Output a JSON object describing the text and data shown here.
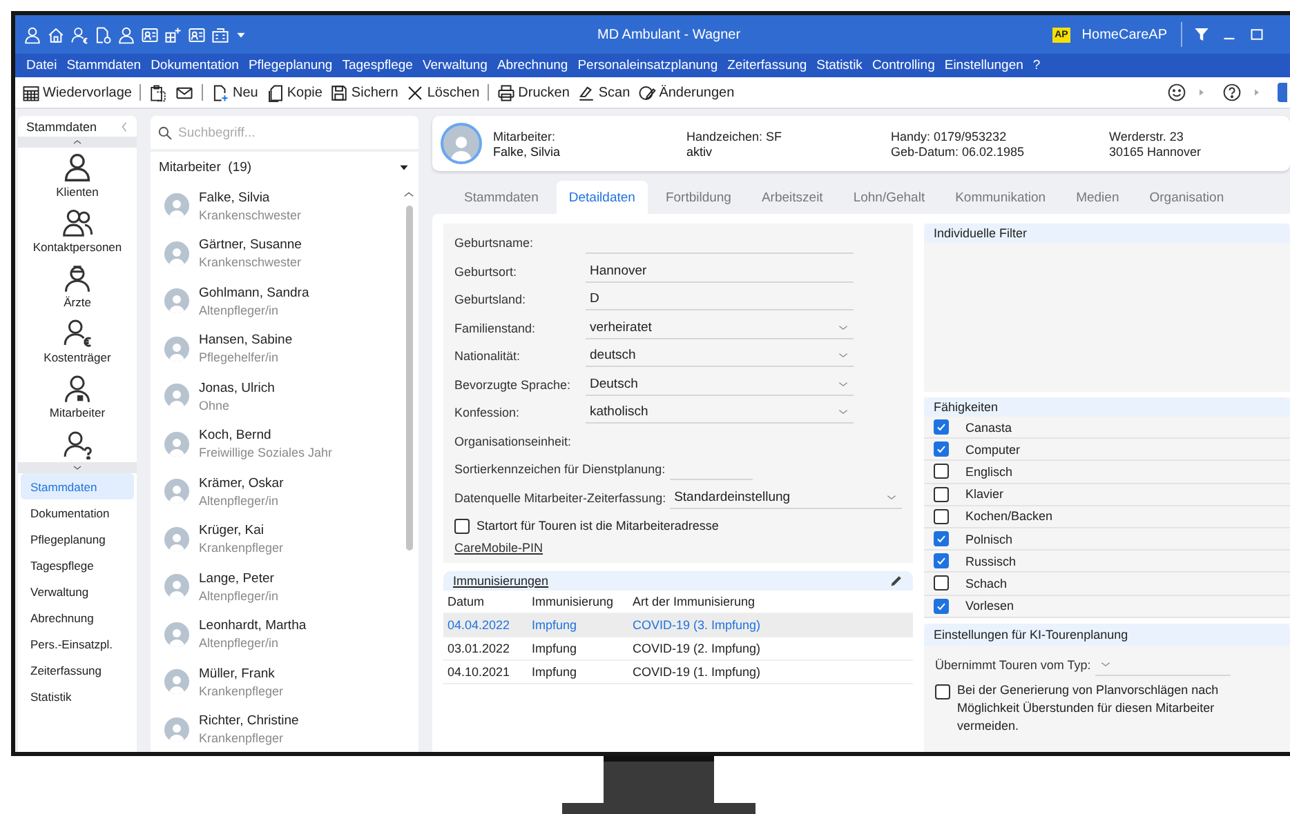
{
  "window": {
    "title": "MD Ambulant - Wagner",
    "brand_badge": "AP",
    "brand": "HomeCareAP"
  },
  "menu": [
    "Datei",
    "Stammdaten",
    "Dokumentation",
    "Pflegeplanung",
    "Tagespflege",
    "Verwaltung",
    "Abrechnung",
    "Personaleinsatzplanung",
    "Zeiterfassung",
    "Statistik",
    "Controlling",
    "Einstellungen",
    "?"
  ],
  "toolbar": [
    "Wiedervorlage",
    "Neu",
    "Kopie",
    "Sichern",
    "Löschen",
    "Drucken",
    "Scan",
    "Änderungen"
  ],
  "nav": {
    "title": "Stammdaten",
    "shortcuts": [
      "Klienten",
      "Kontaktpersonen",
      "Ärzte",
      "Kostenträger",
      "Mitarbeiter"
    ],
    "modules": [
      {
        "label": "Stammdaten",
        "selected": true
      },
      {
        "label": "Dokumentation",
        "selected": false
      },
      {
        "label": "Pflegeplanung",
        "selected": false
      },
      {
        "label": "Tagespflege",
        "selected": false
      },
      {
        "label": "Verwaltung",
        "selected": false
      },
      {
        "label": "Abrechnung",
        "selected": false
      },
      {
        "label": "Pers.-Einsatzpl.",
        "selected": false
      },
      {
        "label": "Zeiterfassung",
        "selected": false
      },
      {
        "label": "Statistik",
        "selected": false
      }
    ]
  },
  "employees": {
    "placeholder": "Suchbegriff...",
    "heading": "Mitarbeiter  (19)",
    "items": [
      {
        "name": "Falke, Silvia",
        "role": "Krankenschwester"
      },
      {
        "name": "Gärtner, Susanne",
        "role": "Krankenschwester"
      },
      {
        "name": "Gohlmann, Sandra",
        "role": "Altenpfleger/in"
      },
      {
        "name": "Hansen, Sabine",
        "role": "Pflegehelfer/in"
      },
      {
        "name": "Jonas, Ulrich",
        "role": "Ohne"
      },
      {
        "name": "Koch, Bernd",
        "role": "Freiwillige Soziales Jahr"
      },
      {
        "name": "Krämer, Oskar",
        "role": "Altenpfleger/in"
      },
      {
        "name": "Krüger, Kai",
        "role": "Krankenpfleger"
      },
      {
        "name": "Lange, Peter",
        "role": "Altenpfleger/in"
      },
      {
        "name": "Leonhardt, Martha",
        "role": "Altenpfleger/in"
      },
      {
        "name": "Müller, Frank",
        "role": "Krankenpfleger"
      },
      {
        "name": "Richter, Christine",
        "role": "Krankenpfleger"
      }
    ]
  },
  "profile": {
    "label": "Mitarbeiter:",
    "name": "Falke, Silvia",
    "initials": "Handzeichen: SF",
    "status": "aktiv",
    "phone": "Handy: 0179/953232",
    "birth": "Geb-Datum: 06.02.1985",
    "street": "Werderstr. 23",
    "city": "30165 Hannover"
  },
  "tabs": [
    {
      "label": "Stammdaten",
      "selected": false
    },
    {
      "label": "Detaildaten",
      "selected": true
    },
    {
      "label": "Fortbildung",
      "selected": false
    },
    {
      "label": "Arbeitszeit",
      "selected": false
    },
    {
      "label": "Lohn/Gehalt",
      "selected": false
    },
    {
      "label": "Kommunikation",
      "selected": false
    },
    {
      "label": "Medien",
      "selected": false
    },
    {
      "label": "Organisation",
      "selected": false
    }
  ],
  "form": {
    "fields": [
      {
        "label": "Geburtsname:",
        "kind": "text"
      },
      {
        "label": "Geburtsort:",
        "kind": "text",
        "value": "Hannover"
      },
      {
        "label": "Geburtsland:",
        "kind": "text",
        "value": "D"
      },
      {
        "label": "Familienstand:",
        "kind": "select",
        "value": "verheiratet"
      },
      {
        "label": "Nationalität:",
        "kind": "select",
        "value": "deutsch"
      },
      {
        "label": "Bevorzugte Sprache:",
        "kind": "select",
        "value": "Deutsch"
      },
      {
        "label": "Konfession:",
        "kind": "select",
        "value": "katholisch"
      },
      {
        "label": "Organisationseinheit:",
        "kind": "plain"
      },
      {
        "label": "Sortierkennzeichen für Dienstplanung:",
        "kind": "short"
      },
      {
        "label": "Datenquelle Mitarbeiter-Zeiterfassung:",
        "kind": "select",
        "value": "Standardeinstellung"
      }
    ],
    "checkbox": {
      "label": "Startort für Touren ist die Mitarbeiteradresse",
      "checked": false
    },
    "link": "CareMobile-PIN"
  },
  "immunizations": {
    "title": "Immunisierungen",
    "columns": [
      "Datum",
      "Immunisierung",
      "Art der Immunisierung"
    ],
    "rows": [
      {
        "cells": [
          "04.04.2022",
          "Impfung",
          "COVID-19 (3. Impfung)"
        ],
        "selected": true
      },
      {
        "cells": [
          "03.01.2022",
          "Impfung",
          "COVID-19 (2. Impfung)"
        ],
        "selected": false
      },
      {
        "cells": [
          "04.10.2021",
          "Impfung",
          "COVID-19 (1. Impfung)"
        ],
        "selected": false
      }
    ]
  },
  "filters": {
    "title": "Individuelle Filter"
  },
  "skills": {
    "title": "Fähigkeiten",
    "items": [
      {
        "label": "Canasta",
        "checked": true
      },
      {
        "label": "Computer",
        "checked": true
      },
      {
        "label": "Englisch",
        "checked": false
      },
      {
        "label": "Klavier",
        "checked": false
      },
      {
        "label": "Kochen/Backen",
        "checked": false
      },
      {
        "label": "Polnisch",
        "checked": true
      },
      {
        "label": "Russisch",
        "checked": true
      },
      {
        "label": "Schach",
        "checked": false
      },
      {
        "label": "Vorlesen",
        "checked": true
      }
    ]
  },
  "ki": {
    "title": "Einstellungen für KI-Tourenplanung",
    "select_label": "Übernimmt Touren vom Typ:",
    "checkbox": {
      "label": "Bei der Generierung von Planvorschlägen nach Möglichkeit Überstunden für diesen Mitarbeiter vermeiden.",
      "checked": false
    }
  }
}
